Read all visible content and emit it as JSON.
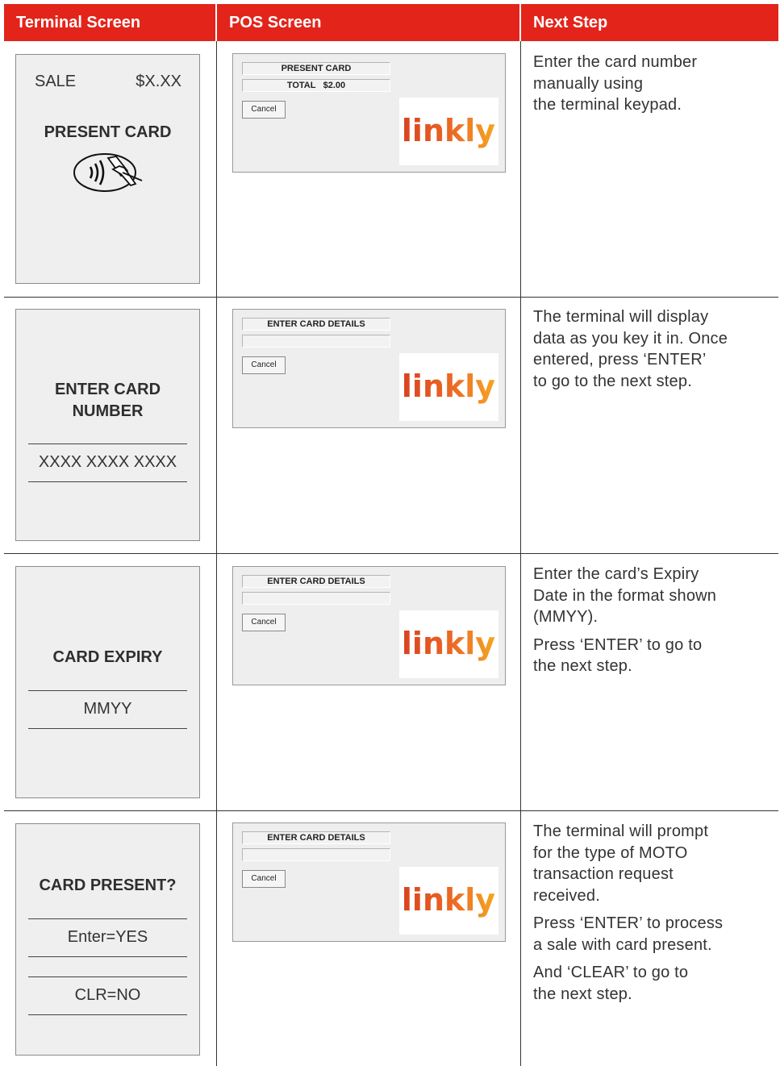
{
  "header": {
    "col1": "Terminal Screen",
    "col2": "POS Screen",
    "col3": "Next Step"
  },
  "colors": {
    "accent": "#e3241b",
    "panel": "#efefef",
    "text": "#333333"
  },
  "rows": [
    {
      "terminal": {
        "sale": "SALE",
        "amount": "$X.XX",
        "title": "PRESENT CARD",
        "icon": "contactless-card-icon"
      },
      "pos": {
        "field1": "PRESENT CARD",
        "field2_label": "TOTAL",
        "field2_value": "$2.00",
        "cancel": "Cancel",
        "logo": "linkly"
      },
      "next": [
        "Enter the card number\nmanually using\nthe terminal keypad."
      ]
    },
    {
      "terminal": {
        "title1": "ENTER CARD",
        "title2": "NUMBER",
        "value": "XXXX XXXX XXXX"
      },
      "pos": {
        "field1": "ENTER CARD DETAILS",
        "cancel": "Cancel",
        "logo": "linkly"
      },
      "next": [
        "The terminal will display\ndata as you key it in. Once\nentered, press ‘ENTER’\nto go to the next step."
      ]
    },
    {
      "terminal": {
        "title": "CARD EXPIRY",
        "value": "MMYY"
      },
      "pos": {
        "field1": "ENTER CARD DETAILS",
        "cancel": "Cancel",
        "logo": "linkly"
      },
      "next": [
        "Enter the card’s Expiry\nDate in the format shown\n(MMYY).",
        "Press ‘ENTER’ to go to\nthe next step."
      ]
    },
    {
      "terminal": {
        "title": "CARD PRESENT?",
        "yes": "Enter=YES",
        "no": "CLR=NO"
      },
      "pos": {
        "field1": "ENTER CARD DETAILS",
        "cancel": "Cancel",
        "logo": "linkly"
      },
      "next": [
        "The terminal will prompt\nfor the type of MOTO\ntransaction request\nreceived.",
        "Press ‘ENTER’ to process\na sale with card present.",
        "And ‘CLEAR’ to go to\nthe next step."
      ]
    }
  ]
}
